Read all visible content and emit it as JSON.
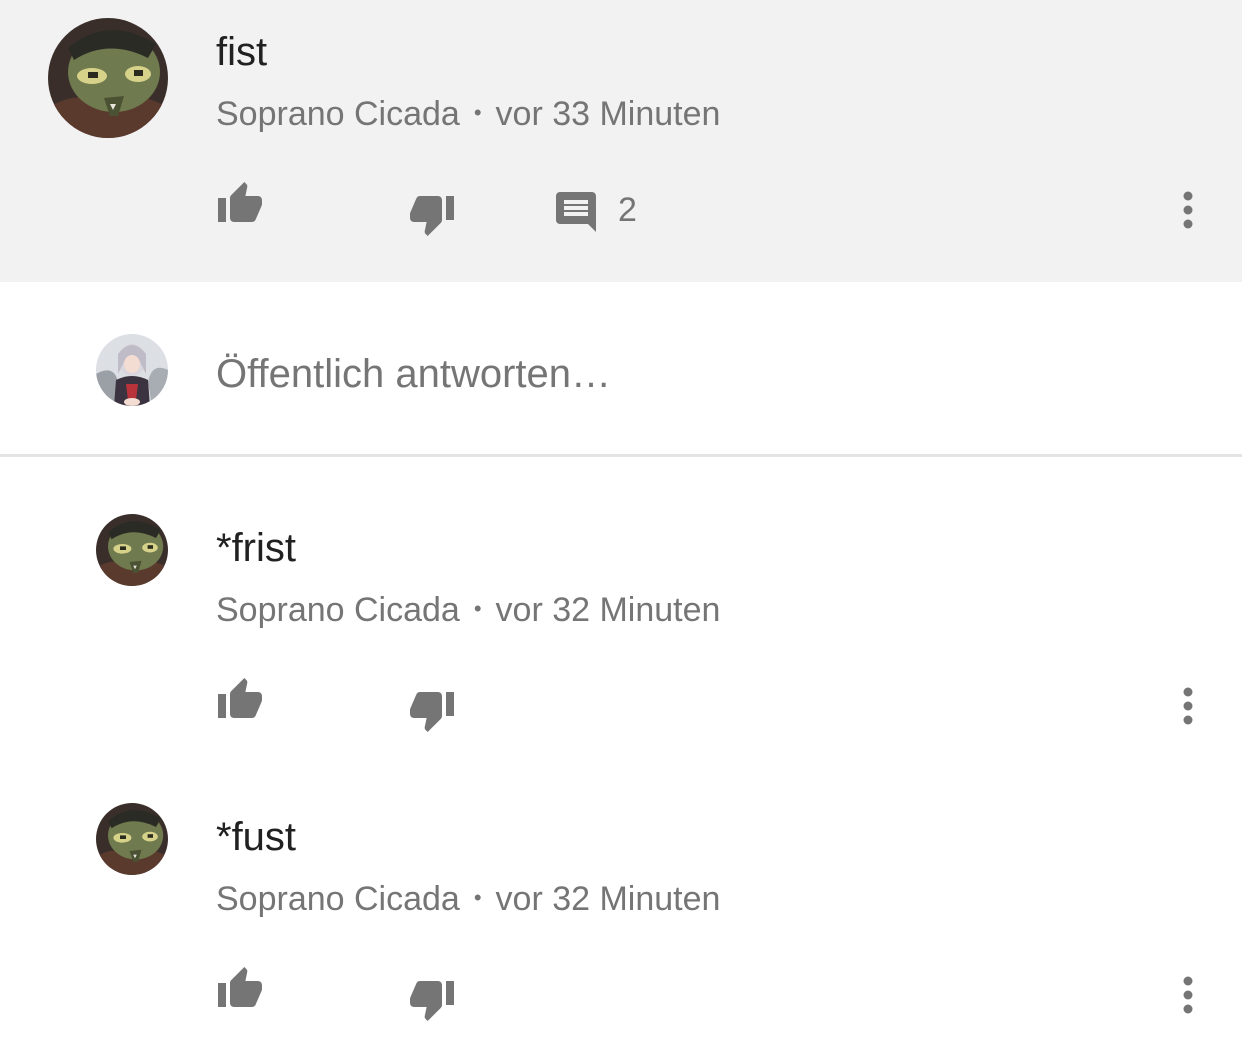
{
  "colors": {
    "highlight_bg": "#f2f2f2",
    "text_primary": "#212121",
    "text_secondary": "#757575",
    "icon": "#757575",
    "divider": "#e4e4e4"
  },
  "top_comment": {
    "text": "fist",
    "author": "Soprano Cicada",
    "separator": "•",
    "time": "vor 33 Minuten",
    "reply_count": "2",
    "icons": [
      "avatar",
      "thumb-up-icon",
      "thumb-down-icon",
      "comment-icon",
      "more-vert-icon"
    ]
  },
  "reply_box": {
    "placeholder": "Öffentlich antworten…",
    "icons": [
      "user-avatar"
    ]
  },
  "replies": [
    {
      "text": "*frist",
      "author": "Soprano Cicada",
      "separator": "•",
      "time": "vor 32 Minuten"
    },
    {
      "text": "*fust",
      "author": "Soprano Cicada",
      "separator": "•",
      "time": "vor 32 Minuten"
    }
  ]
}
